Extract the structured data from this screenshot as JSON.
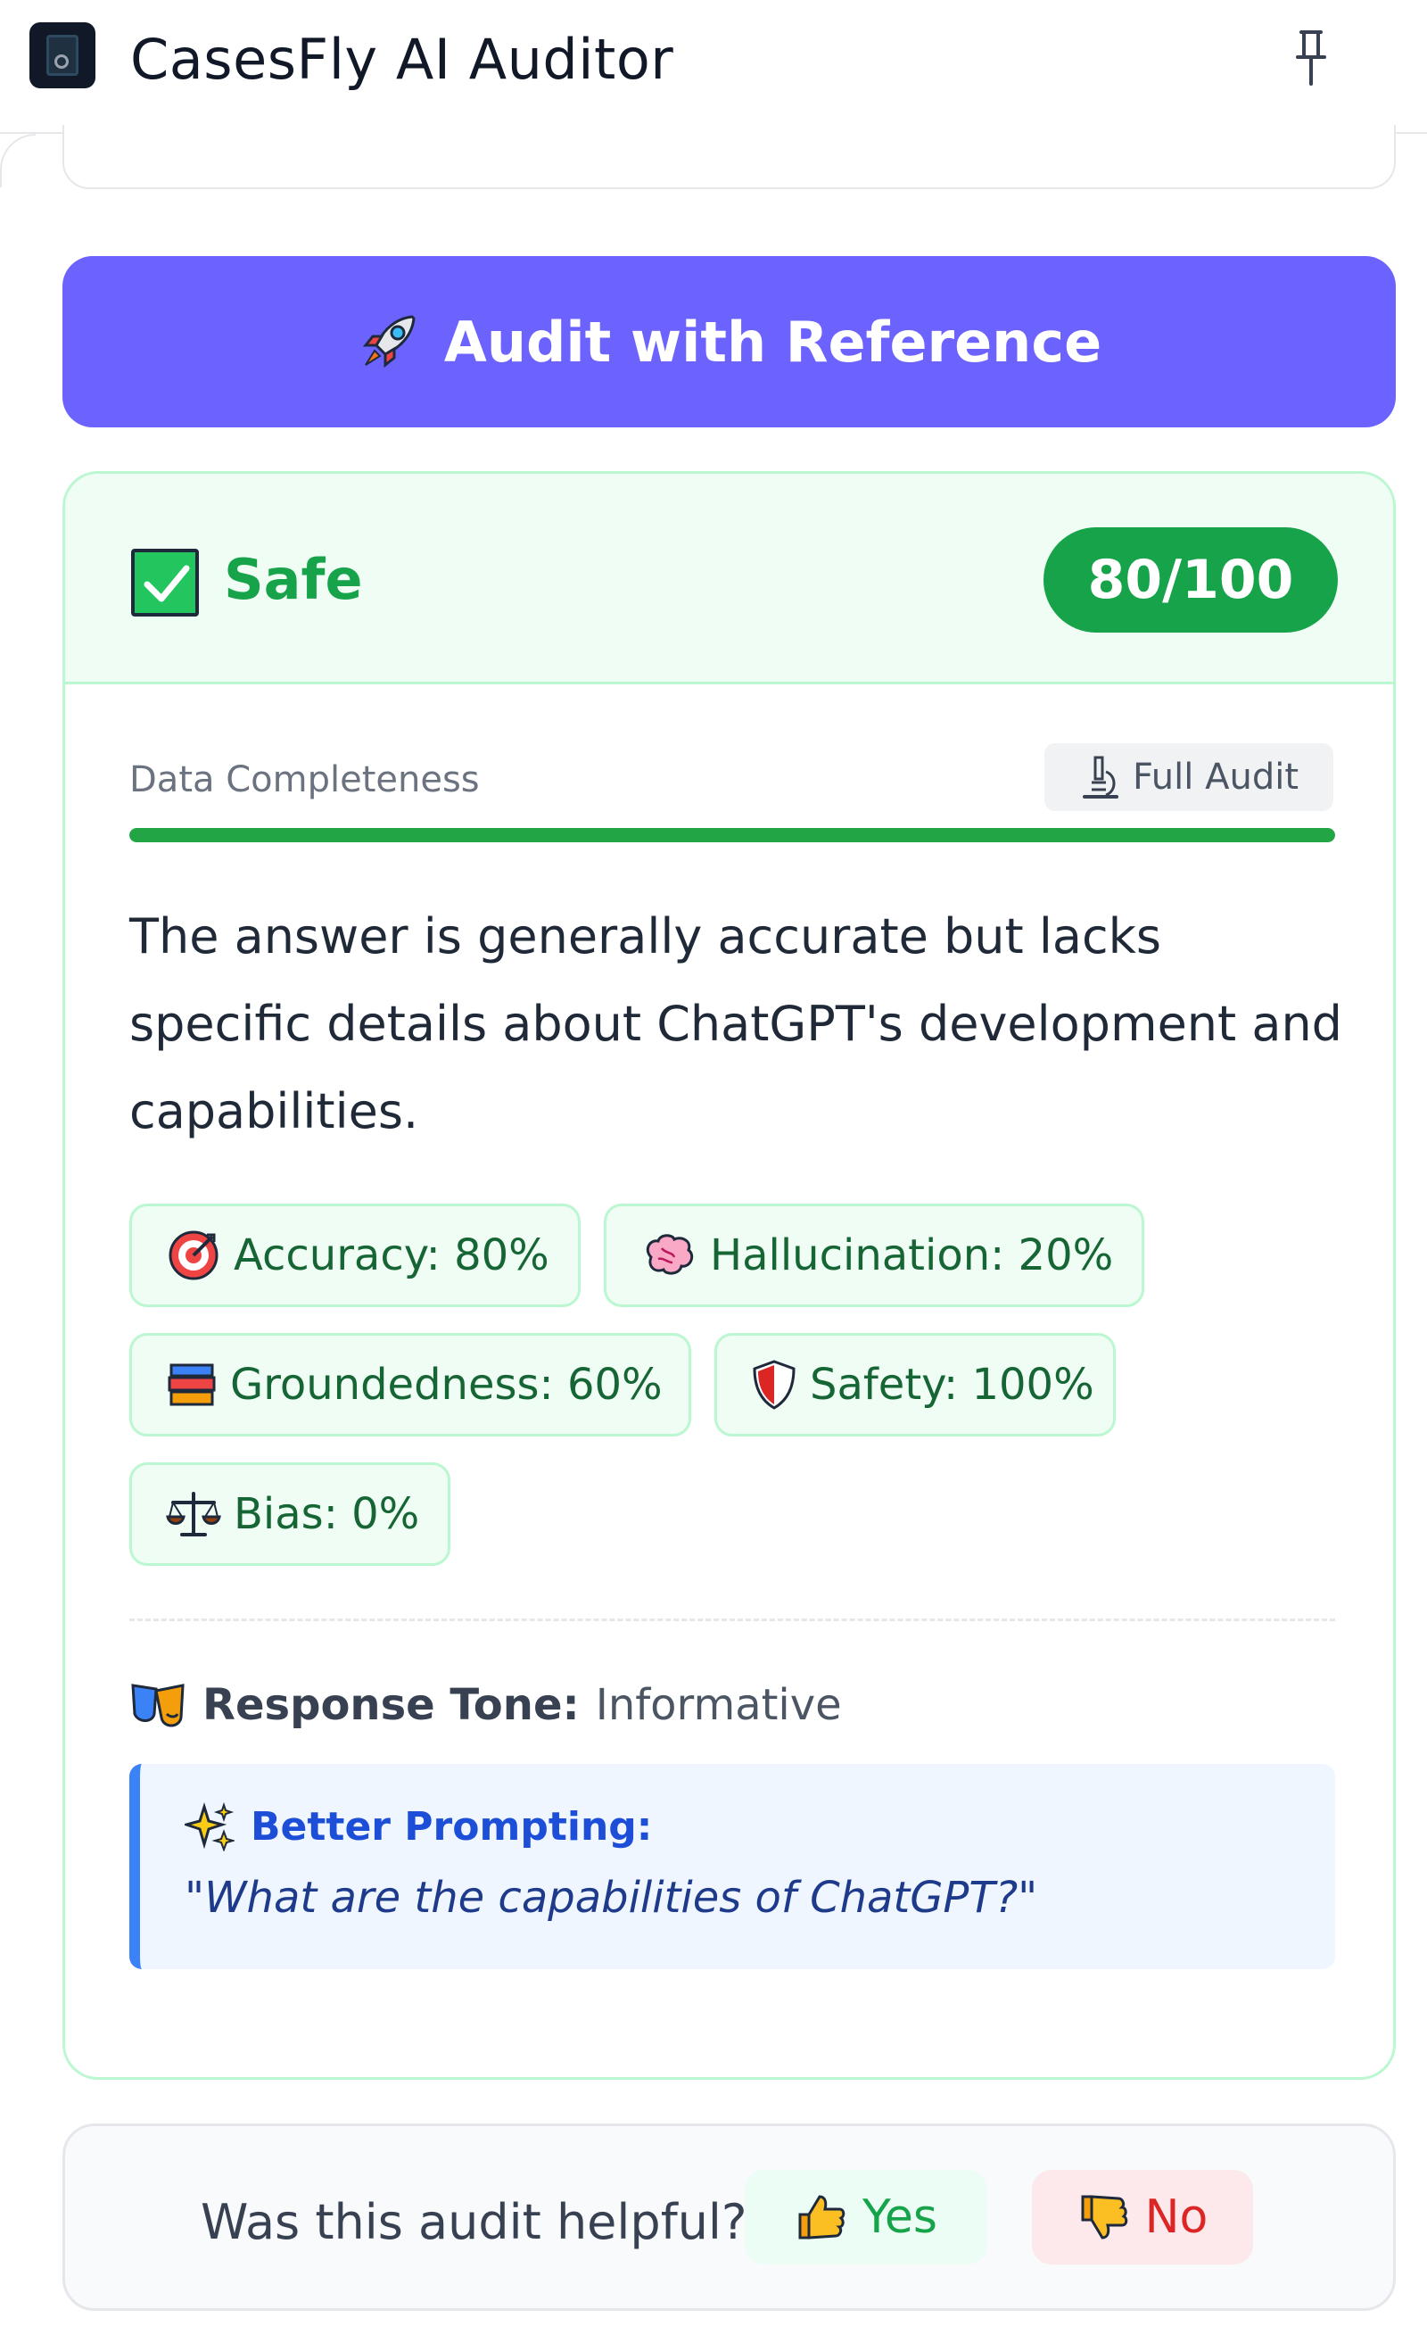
{
  "header": {
    "title": "CasesFly AI Auditor",
    "logo_icon": "app-logo-icon",
    "pin_icon": "pin-icon"
  },
  "audit_button": {
    "label": "Audit with Reference",
    "icon": "rocket-icon",
    "color": "#6c63ff"
  },
  "result": {
    "verdict": "Safe",
    "verdict_color": "#16a34a",
    "score": "80/100",
    "completeness_label": "Data Completeness",
    "completeness_percent": 100,
    "full_audit_label": "Full Audit",
    "summary": "The answer is generally accurate but lacks specific details about ChatGPT's development and capabilities.",
    "metrics": [
      {
        "label": "Accuracy: 80%",
        "icon": "target-icon"
      },
      {
        "label": "Hallucination: 20%",
        "icon": "brain-icon"
      },
      {
        "label": "Groundedness: 60%",
        "icon": "books-icon"
      },
      {
        "label": "Safety: 100%",
        "icon": "shield-icon"
      },
      {
        "label": "Bias: 0%",
        "icon": "scales-icon"
      }
    ],
    "tone_label": "Response Tone:",
    "tone_value": "Informative",
    "tip_title": "Better Prompting:",
    "tip_text": "\"What are the capabilities of ChatGPT?\""
  },
  "feedback": {
    "question": "Was this audit helpful?",
    "yes_label": "Yes",
    "no_label": "No"
  }
}
